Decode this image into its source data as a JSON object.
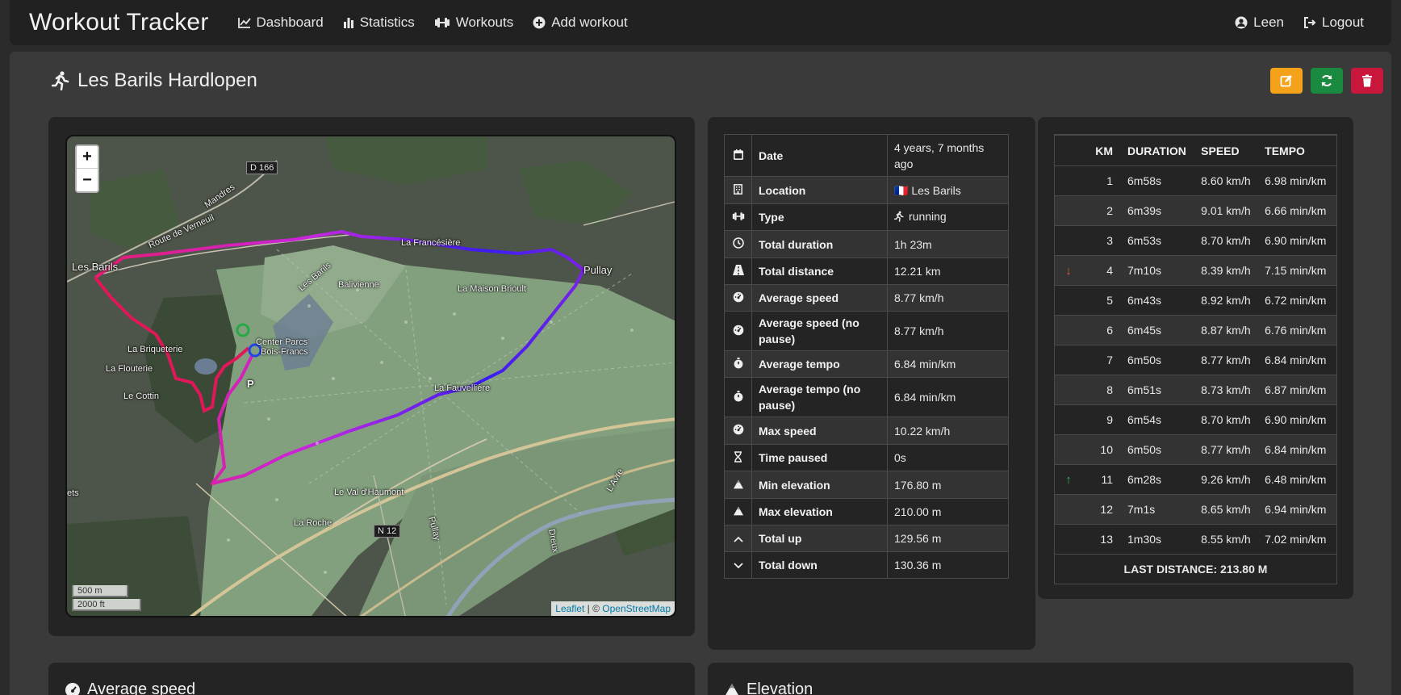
{
  "app": {
    "brand": "Workout Tracker",
    "nav": [
      {
        "label": "Dashboard",
        "icon": "chart-line-icon"
      },
      {
        "label": "Statistics",
        "icon": "bar-chart-icon"
      },
      {
        "label": "Workouts",
        "icon": "dumbbell-icon"
      },
      {
        "label": "Add workout",
        "icon": "plus-circle-icon"
      }
    ],
    "user": {
      "label": "Leen",
      "icon": "user-circle-icon"
    },
    "logout": {
      "label": "Logout",
      "icon": "logout-icon"
    }
  },
  "workout": {
    "title": "Les Barils Hardlopen",
    "title_icon": "running-icon",
    "actions": [
      {
        "name": "edit",
        "icon": "edit-icon",
        "color": "#f4a21a"
      },
      {
        "name": "refresh",
        "icon": "refresh-icon",
        "color": "#198a3f"
      },
      {
        "name": "delete",
        "icon": "trash-icon",
        "color": "#c9163b"
      }
    ]
  },
  "map": {
    "zoom_in": "+",
    "zoom_out": "−",
    "scale_metric": "500 m",
    "scale_imperial": "2000 ft",
    "attribution_leaflet": "Leaflet",
    "attribution_sep": " | © ",
    "attribution_osm": "OpenStreetMap",
    "labels": {
      "d166": "D 166",
      "mandres": "Mandres",
      "route_verneuil": "Route de Verneuil",
      "les_barils": "Les Barils",
      "la_francesiere": "La Francésière",
      "pullay": "Pullay",
      "les_barils_road": "Les Barils",
      "balivienne": "Balivienne",
      "la_maison_brioult": "La Maison Brioult",
      "center_parcs": "Center Parcs",
      "bois_francs": "Bois-Francs",
      "la_briqueterie": "La Briqueterie",
      "la_flouterie": "La Flouterie",
      "le_cottin": "Le Cottin",
      "p": "P",
      "la_fauvelliere": "La Fauvellière",
      "le_val_haumont": "Le Val d'Haumont",
      "la_roche": "La Roche",
      "n12": "N 12",
      "pullay_road": "Pullay",
      "avre": "L'Avre",
      "dreux": "Dreux",
      "ets": "ets"
    }
  },
  "details": [
    {
      "icon": "calendar-icon",
      "label": "Date",
      "value": "4 years, 7 months ago"
    },
    {
      "icon": "building-icon",
      "label": "Location",
      "value": "🇫🇷 Les Barils"
    },
    {
      "icon": "dumbbell-icon",
      "label": "Type",
      "value": "running",
      "value_icon": "running-icon"
    },
    {
      "icon": "clock-icon",
      "label": "Total duration",
      "value": "1h 23m"
    },
    {
      "icon": "road-icon",
      "label": "Total distance",
      "value": "12.21 km"
    },
    {
      "icon": "gauge-icon",
      "label": "Average speed",
      "value": "8.77 km/h"
    },
    {
      "icon": "gauge-icon",
      "label": "Average speed (no pause)",
      "value": "8.77 km/h"
    },
    {
      "icon": "stopwatch-icon",
      "label": "Average tempo",
      "value": "6.84 min/km"
    },
    {
      "icon": "stopwatch-icon",
      "label": "Average tempo (no pause)",
      "value": "6.84 min/km"
    },
    {
      "icon": "gauge-icon",
      "label": "Max speed",
      "value": "10.22 km/h"
    },
    {
      "icon": "hourglass-icon",
      "label": "Time paused",
      "value": "0s"
    },
    {
      "icon": "mountain-icon",
      "label": "Min elevation",
      "value": "176.80 m"
    },
    {
      "icon": "mountain-icon",
      "label": "Max elevation",
      "value": "210.00 m"
    },
    {
      "icon": "chevron-up-icon",
      "label": "Total up",
      "value": "129.56 m"
    },
    {
      "icon": "chevron-down-icon",
      "label": "Total down",
      "value": "130.36 m"
    }
  ],
  "splits": {
    "headers": [
      "",
      "KM",
      "DURATION",
      "SPEED",
      "TEMPO"
    ],
    "rows": [
      {
        "km": "1",
        "duration": "6m58s",
        "speed": "8.60 km/h",
        "tempo": "6.98 min/km",
        "marker": ""
      },
      {
        "km": "2",
        "duration": "6m39s",
        "speed": "9.01 km/h",
        "tempo": "6.66 min/km",
        "marker": ""
      },
      {
        "km": "3",
        "duration": "6m53s",
        "speed": "8.70 km/h",
        "tempo": "6.90 min/km",
        "marker": ""
      },
      {
        "km": "4",
        "duration": "7m10s",
        "speed": "8.39 km/h",
        "tempo": "7.15 min/km",
        "marker": "slowest"
      },
      {
        "km": "5",
        "duration": "6m43s",
        "speed": "8.92 km/h",
        "tempo": "6.72 min/km",
        "marker": ""
      },
      {
        "km": "6",
        "duration": "6m45s",
        "speed": "8.87 km/h",
        "tempo": "6.76 min/km",
        "marker": ""
      },
      {
        "km": "7",
        "duration": "6m50s",
        "speed": "8.77 km/h",
        "tempo": "6.84 min/km",
        "marker": ""
      },
      {
        "km": "8",
        "duration": "6m51s",
        "speed": "8.73 km/h",
        "tempo": "6.87 min/km",
        "marker": ""
      },
      {
        "km": "9",
        "duration": "6m54s",
        "speed": "8.70 km/h",
        "tempo": "6.90 min/km",
        "marker": ""
      },
      {
        "km": "10",
        "duration": "6m50s",
        "speed": "8.77 km/h",
        "tempo": "6.84 min/km",
        "marker": ""
      },
      {
        "km": "11",
        "duration": "6m28s",
        "speed": "9.26 km/h",
        "tempo": "6.48 min/km",
        "marker": "fastest"
      },
      {
        "km": "12",
        "duration": "7m1s",
        "speed": "8.65 km/h",
        "tempo": "6.94 min/km",
        "marker": ""
      },
      {
        "km": "13",
        "duration": "1m30s",
        "speed": "8.55 km/h",
        "tempo": "7.02 min/km",
        "marker": ""
      }
    ],
    "footer": "LAST DISTANCE: 213.80 M",
    "marker_colors": {
      "slowest": "#e8582c",
      "fastest": "#3fae5a"
    }
  },
  "sections": {
    "average_speed": {
      "title": "Average speed",
      "icon": "gauge-icon"
    },
    "elevation": {
      "title": "Elevation",
      "icon": "mountain-icon"
    }
  }
}
